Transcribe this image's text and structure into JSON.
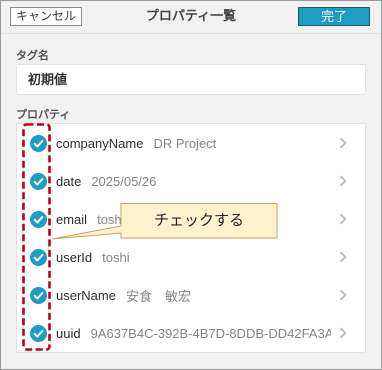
{
  "header": {
    "cancel_label": "キャンセル",
    "title": "プロパティ一覧",
    "done_label": "完了"
  },
  "tag_name": {
    "label": "タグ名",
    "value": "初期値"
  },
  "properties": {
    "label": "プロパティ",
    "items": [
      {
        "key": "companyName",
        "value": "DR Project",
        "checked": true
      },
      {
        "key": "date",
        "value": "2025/05/26",
        "checked": true
      },
      {
        "key": "email",
        "value": "tosh",
        "checked": true
      },
      {
        "key": "userId",
        "value": "toshi",
        "checked": true
      },
      {
        "key": "userName",
        "value": "安食　敏宏",
        "checked": true
      },
      {
        "key": "uuid",
        "value": "9A637B4C-392B-4B7D-8DDB-DD42FA3A",
        "checked": true
      }
    ]
  },
  "annotation": {
    "text": "チェックする"
  },
  "icons": {
    "check": "check-circle-icon",
    "chevron": "chevron-right-icon"
  },
  "colors": {
    "accent": "#1d9cc6",
    "annotation_outline": "#c00018",
    "callout_fill": "#fff2cc",
    "callout_stroke": "#caa35a"
  }
}
